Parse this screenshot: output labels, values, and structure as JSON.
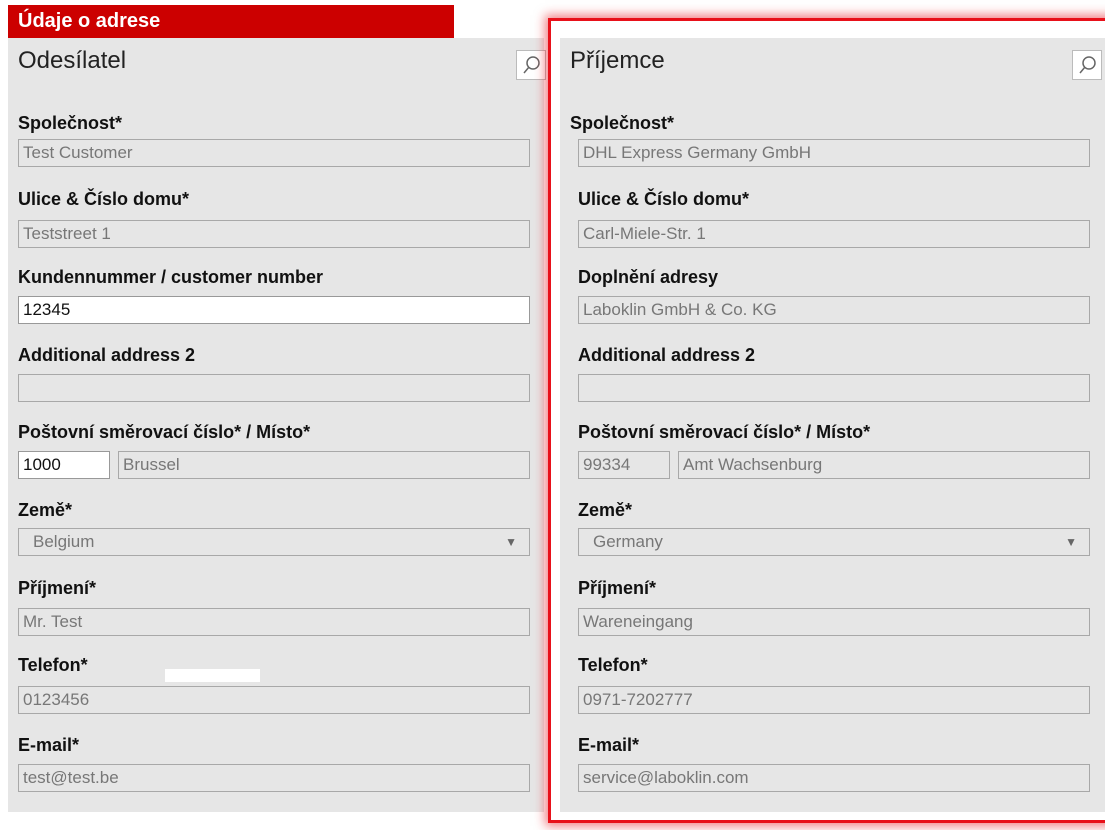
{
  "section_title": "Údaje o adrese",
  "sender": {
    "title": "Odesílatel",
    "company_label": "Společnost*",
    "company_value": "Test Customer",
    "street_label": "Ulice & Číslo domu*",
    "street_value": "Teststreet 1",
    "customer_number_label": "Kundennummer / customer number",
    "customer_number_value": "12345",
    "additional2_label": "Additional address 2",
    "additional2_value": "",
    "zip_city_label": "Poštovní směrovací číslo* / Místo*",
    "zip_value": "1000",
    "city_value": "Brussel",
    "country_label": "Země*",
    "country_value": "Belgium",
    "surname_label": "Příjmení*",
    "surname_value": "Mr. Test",
    "phone_label": "Telefon*",
    "phone_value": "0123456",
    "email_label": "E-mail*",
    "email_value": "test@test.be"
  },
  "recipient": {
    "title": "Příjemce",
    "company_label": "Společnost*",
    "company_value": "DHL Express Germany GmbH",
    "street_label": "Ulice & Číslo domu*",
    "street_value": "Carl-Miele-Str. 1",
    "additional1_label": "Doplnění adresy",
    "additional1_value": "Laboklin GmbH & Co. KG",
    "additional2_label": "Additional address 2",
    "additional2_value": "",
    "zip_city_label": "Poštovní směrovací číslo* / Místo*",
    "zip_value": "99334",
    "city_value": "Amt Wachsenburg",
    "country_label": "Země*",
    "country_value": "Germany",
    "surname_label": "Příjmení*",
    "surname_value": "Wareneingang",
    "phone_label": "Telefon*",
    "phone_value": "0971-7202777",
    "email_label": "E-mail*",
    "email_value": "service@laboklin.com"
  },
  "icons": {
    "lookup": "magnifier-icon",
    "dropdown": "triangle-down-icon"
  },
  "colors": {
    "header_red": "#cc0000",
    "panel_gray": "#e6e6e6",
    "highlight_red": "#e8111a"
  }
}
